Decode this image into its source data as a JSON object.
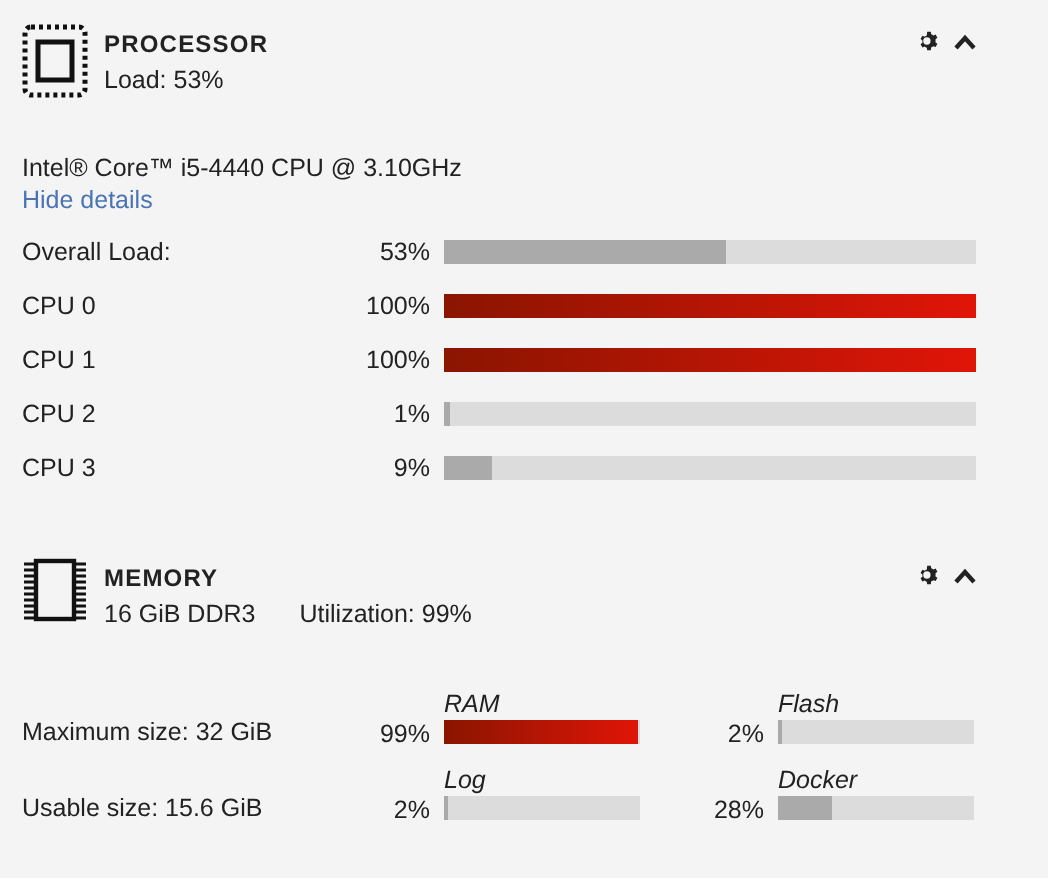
{
  "processor": {
    "title": "PROCESSOR",
    "load": "Load: 53%",
    "model": "Intel® Core™ i5-4440 CPU @ 3.10GHz",
    "details_link": "Hide details",
    "rows": [
      {
        "label": "Overall Load:",
        "reading": "53%",
        "level": 0.53
      },
      {
        "label": "CPU 0",
        "reading": "100%",
        "level": 1.0
      },
      {
        "label": "CPU 1",
        "reading": "100%",
        "level": 1.0
      },
      {
        "label": "CPU 2",
        "reading": "1%",
        "level": 0.01
      },
      {
        "label": "CPU 3",
        "reading": "9%",
        "level": 0.09
      }
    ]
  },
  "memory": {
    "title": "MEMORY",
    "size": "16 GiB DDR3",
    "utilization": "Utilization: 99%",
    "sizes": [
      "Maximum size: 32 GiB",
      "Usable size: 15.6 GiB"
    ],
    "gauges": [
      {
        "name": "RAM",
        "reading": "99%",
        "level": 0.99
      },
      {
        "name": "Flash",
        "reading": "2%",
        "level": 0.02
      },
      {
        "name": "Log",
        "reading": "2%",
        "level": 0.02
      },
      {
        "name": "Docker",
        "reading": "28%",
        "level": 0.28
      }
    ]
  }
}
